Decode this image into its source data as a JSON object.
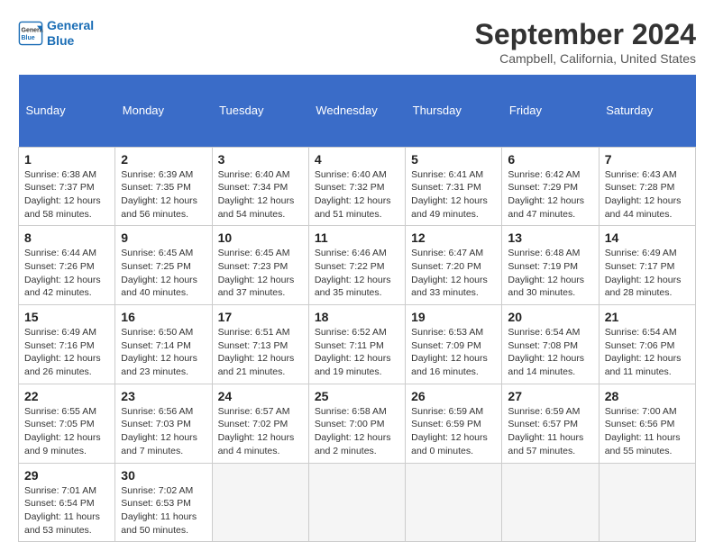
{
  "logo": {
    "line1": "General",
    "line2": "Blue"
  },
  "title": "September 2024",
  "subtitle": "Campbell, California, United States",
  "days_header": [
    "Sunday",
    "Monday",
    "Tuesday",
    "Wednesday",
    "Thursday",
    "Friday",
    "Saturday"
  ],
  "weeks": [
    [
      {
        "day": "1",
        "info": "Sunrise: 6:38 AM\nSunset: 7:37 PM\nDaylight: 12 hours\nand 58 minutes."
      },
      {
        "day": "2",
        "info": "Sunrise: 6:39 AM\nSunset: 7:35 PM\nDaylight: 12 hours\nand 56 minutes."
      },
      {
        "day": "3",
        "info": "Sunrise: 6:40 AM\nSunset: 7:34 PM\nDaylight: 12 hours\nand 54 minutes."
      },
      {
        "day": "4",
        "info": "Sunrise: 6:40 AM\nSunset: 7:32 PM\nDaylight: 12 hours\nand 51 minutes."
      },
      {
        "day": "5",
        "info": "Sunrise: 6:41 AM\nSunset: 7:31 PM\nDaylight: 12 hours\nand 49 minutes."
      },
      {
        "day": "6",
        "info": "Sunrise: 6:42 AM\nSunset: 7:29 PM\nDaylight: 12 hours\nand 47 minutes."
      },
      {
        "day": "7",
        "info": "Sunrise: 6:43 AM\nSunset: 7:28 PM\nDaylight: 12 hours\nand 44 minutes."
      }
    ],
    [
      {
        "day": "8",
        "info": "Sunrise: 6:44 AM\nSunset: 7:26 PM\nDaylight: 12 hours\nand 42 minutes."
      },
      {
        "day": "9",
        "info": "Sunrise: 6:45 AM\nSunset: 7:25 PM\nDaylight: 12 hours\nand 40 minutes."
      },
      {
        "day": "10",
        "info": "Sunrise: 6:45 AM\nSunset: 7:23 PM\nDaylight: 12 hours\nand 37 minutes."
      },
      {
        "day": "11",
        "info": "Sunrise: 6:46 AM\nSunset: 7:22 PM\nDaylight: 12 hours\nand 35 minutes."
      },
      {
        "day": "12",
        "info": "Sunrise: 6:47 AM\nSunset: 7:20 PM\nDaylight: 12 hours\nand 33 minutes."
      },
      {
        "day": "13",
        "info": "Sunrise: 6:48 AM\nSunset: 7:19 PM\nDaylight: 12 hours\nand 30 minutes."
      },
      {
        "day": "14",
        "info": "Sunrise: 6:49 AM\nSunset: 7:17 PM\nDaylight: 12 hours\nand 28 minutes."
      }
    ],
    [
      {
        "day": "15",
        "info": "Sunrise: 6:49 AM\nSunset: 7:16 PM\nDaylight: 12 hours\nand 26 minutes."
      },
      {
        "day": "16",
        "info": "Sunrise: 6:50 AM\nSunset: 7:14 PM\nDaylight: 12 hours\nand 23 minutes."
      },
      {
        "day": "17",
        "info": "Sunrise: 6:51 AM\nSunset: 7:13 PM\nDaylight: 12 hours\nand 21 minutes."
      },
      {
        "day": "18",
        "info": "Sunrise: 6:52 AM\nSunset: 7:11 PM\nDaylight: 12 hours\nand 19 minutes."
      },
      {
        "day": "19",
        "info": "Sunrise: 6:53 AM\nSunset: 7:09 PM\nDaylight: 12 hours\nand 16 minutes."
      },
      {
        "day": "20",
        "info": "Sunrise: 6:54 AM\nSunset: 7:08 PM\nDaylight: 12 hours\nand 14 minutes."
      },
      {
        "day": "21",
        "info": "Sunrise: 6:54 AM\nSunset: 7:06 PM\nDaylight: 12 hours\nand 11 minutes."
      }
    ],
    [
      {
        "day": "22",
        "info": "Sunrise: 6:55 AM\nSunset: 7:05 PM\nDaylight: 12 hours\nand 9 minutes."
      },
      {
        "day": "23",
        "info": "Sunrise: 6:56 AM\nSunset: 7:03 PM\nDaylight: 12 hours\nand 7 minutes."
      },
      {
        "day": "24",
        "info": "Sunrise: 6:57 AM\nSunset: 7:02 PM\nDaylight: 12 hours\nand 4 minutes."
      },
      {
        "day": "25",
        "info": "Sunrise: 6:58 AM\nSunset: 7:00 PM\nDaylight: 12 hours\nand 2 minutes."
      },
      {
        "day": "26",
        "info": "Sunrise: 6:59 AM\nSunset: 6:59 PM\nDaylight: 12 hours\nand 0 minutes."
      },
      {
        "day": "27",
        "info": "Sunrise: 6:59 AM\nSunset: 6:57 PM\nDaylight: 11 hours\nand 57 minutes."
      },
      {
        "day": "28",
        "info": "Sunrise: 7:00 AM\nSunset: 6:56 PM\nDaylight: 11 hours\nand 55 minutes."
      }
    ],
    [
      {
        "day": "29",
        "info": "Sunrise: 7:01 AM\nSunset: 6:54 PM\nDaylight: 11 hours\nand 53 minutes."
      },
      {
        "day": "30",
        "info": "Sunrise: 7:02 AM\nSunset: 6:53 PM\nDaylight: 11 hours\nand 50 minutes."
      },
      {
        "day": "",
        "info": ""
      },
      {
        "day": "",
        "info": ""
      },
      {
        "day": "",
        "info": ""
      },
      {
        "day": "",
        "info": ""
      },
      {
        "day": "",
        "info": ""
      }
    ]
  ]
}
